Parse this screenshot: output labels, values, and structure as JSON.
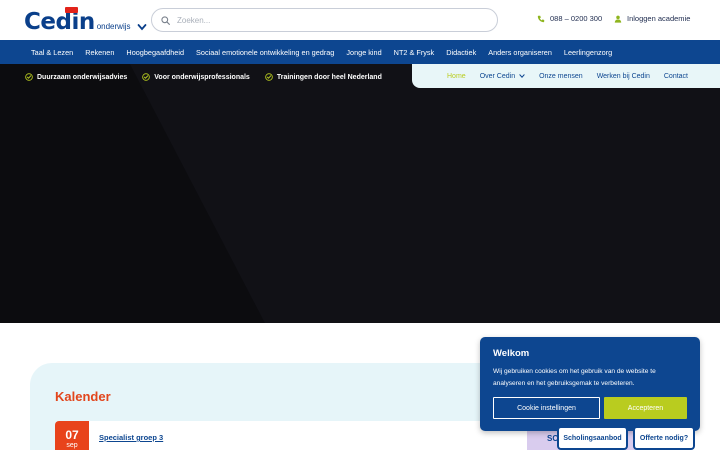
{
  "header": {
    "logo_text": "Cedin",
    "logo_sub": "onderwijs",
    "search_placeholder": "Zoeken...",
    "phone": "088 – 0200 300",
    "login": "Inloggen academie"
  },
  "main_nav": [
    "Taal & Lezen",
    "Rekenen",
    "Hoogbegaafdheid",
    "Sociaal emotionele ontwikkeling en gedrag",
    "Jonge kind",
    "NT2 & Frysk",
    "Didactiek",
    "Anders organiseren",
    "Leerlingenzorg"
  ],
  "usps": [
    "Duurzaam onderwijsadvies",
    "Voor onderwijsprofessionals",
    "Trainingen door heel Nederland"
  ],
  "sub_nav": {
    "home": "Home",
    "about": "Over Cedin",
    "people": "Onze mensen",
    "jobs": "Werken bij Cedin",
    "contact": "Contact"
  },
  "calendar": {
    "title": "Kalender",
    "event": {
      "day": "07",
      "month": "sep",
      "title": "Specialist groep 3"
    }
  },
  "side_card": {
    "text": "SC"
  },
  "cookie": {
    "title": "Welkom",
    "text": "Wij gebruiken cookies om het gebruik van de website te analyseren en het gebruiksgemak te verbeteren.",
    "settings_label": "Cookie instellingen",
    "accept_label": "Accepteren"
  },
  "floating": {
    "training": "Scholingsaanbod",
    "quote": "Offerte nodig?"
  },
  "colors": {
    "brand_blue": "#0d4690",
    "accent_green": "#b9cc1f",
    "accent_orange": "#e8431b",
    "hero_bg": "#111116"
  }
}
